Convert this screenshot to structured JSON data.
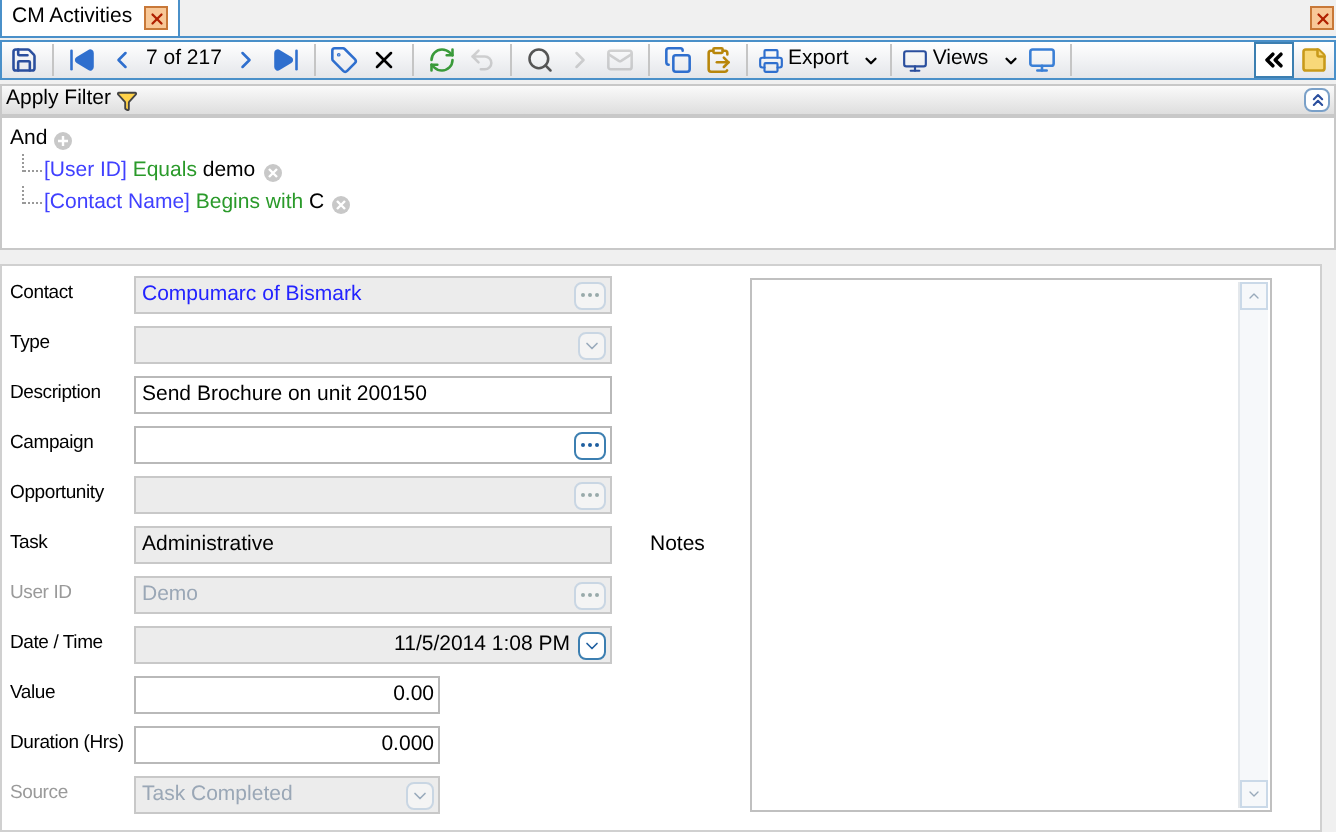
{
  "tab": {
    "label": "CM Activities",
    "selected": true
  },
  "toolbar": {
    "position": "7 of 217",
    "export": "Export",
    "views": "Views"
  },
  "filter": {
    "title": "Apply Filter",
    "root": "And",
    "conditions": [
      {
        "field": "[User ID]",
        "operator": "Equals",
        "value": "demo"
      },
      {
        "field": "[Contact Name]",
        "operator": "Begins with",
        "value": "C"
      }
    ]
  },
  "form": {
    "fields": [
      {
        "label": "Contact",
        "kind": "lookup",
        "value": "Compumarc of Bismark",
        "readonly": true,
        "disabled": false
      },
      {
        "label": "Type",
        "kind": "dropdown",
        "readonly": true,
        "disabled": false
      },
      {
        "label": "Description",
        "kind": "text",
        "value": "Send Brochure on unit 200150",
        "readonly": false,
        "disabled": false
      },
      {
        "label": "Campaign",
        "kind": "lookup",
        "readonly": false,
        "disabled": false
      },
      {
        "label": "Opportunity",
        "kind": "lookup",
        "readonly": true,
        "disabled": false
      },
      {
        "label": "Task",
        "kind": "text",
        "value": "Administrative",
        "readonly": true,
        "disabled": false
      },
      {
        "label": "User ID",
        "kind": "lookup",
        "value": "Demo",
        "readonly": true,
        "disabled": true
      },
      {
        "label": "Date / Time",
        "kind": "datetime",
        "value": "11/5/2014 1:08 PM",
        "readonly": true,
        "disabled": false
      },
      {
        "label": "Value",
        "kind": "number",
        "value": "0.00",
        "readonly": false,
        "disabled": false
      },
      {
        "label": "Duration (Hrs)",
        "kind": "number",
        "value": "0.000",
        "readonly": false,
        "disabled": false
      },
      {
        "label": "Source",
        "kind": "short_dropdown",
        "value": "Task Completed",
        "readonly": true,
        "disabled": true
      }
    ],
    "notes": {
      "label": "Notes"
    }
  }
}
